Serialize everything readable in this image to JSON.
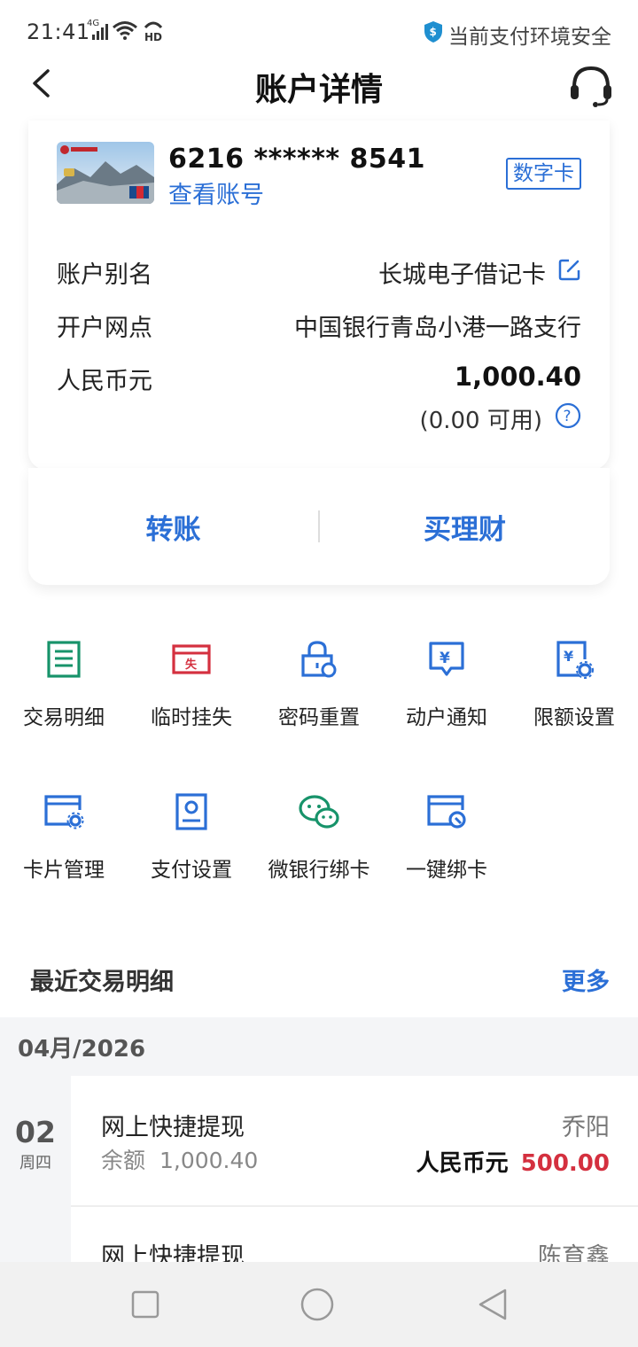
{
  "status_bar": {
    "time": "21:41",
    "network": "4G",
    "safe_text": "当前支付环境安全"
  },
  "header": {
    "title": "账户详情"
  },
  "card": {
    "number": "6216 ****** 8541",
    "view_account": "查看账号",
    "badge": "数字卡",
    "rows": {
      "alias_label": "账户别名",
      "alias_value": "长城电子借记卡",
      "branch_label": "开户网点",
      "branch_value": "中国银行青岛小港一路支行",
      "currency_label": "人民币元",
      "balance": "1,000.40",
      "available": "(0.00 可用)"
    },
    "actions": {
      "transfer": "转账",
      "buy_wealth": "买理财"
    }
  },
  "functions": [
    {
      "label": "交易明细",
      "icon": "list-icon",
      "color": "#17936a"
    },
    {
      "label": "临时挂失",
      "icon": "lost-icon",
      "color": "#d4303f"
    },
    {
      "label": "密码重置",
      "icon": "lock-reset-icon",
      "color": "#2b6fd6"
    },
    {
      "label": "动户通知",
      "icon": "yuan-notice-icon",
      "color": "#2b6fd6"
    },
    {
      "label": "限额设置",
      "icon": "yuan-settings-icon",
      "color": "#2b6fd6"
    },
    {
      "label": "卡片管理",
      "icon": "card-gear-icon",
      "color": "#2b6fd6"
    },
    {
      "label": "支付设置",
      "icon": "pay-settings-icon",
      "color": "#2b6fd6"
    },
    {
      "label": "微银行绑卡",
      "icon": "wechat-icon",
      "color": "#17936a"
    },
    {
      "label": "一键绑卡",
      "icon": "card-bind-icon",
      "color": "#2b6fd6"
    }
  ],
  "recent": {
    "title": "最近交易明细",
    "more": "更多",
    "month": "04月/2026",
    "day": "02",
    "weekday": "周四",
    "transactions": [
      {
        "name": "网上快捷提现",
        "balance_label": "余额",
        "balance": "1,000.40",
        "party": "乔阳",
        "currency": "人民币元",
        "amount": "500.00"
      },
      {
        "name": "网上快捷提现",
        "party": "陈育鑫"
      }
    ]
  },
  "colors": {
    "accent": "#2b6fd6",
    "green": "#17936a",
    "red": "#d4303f"
  }
}
